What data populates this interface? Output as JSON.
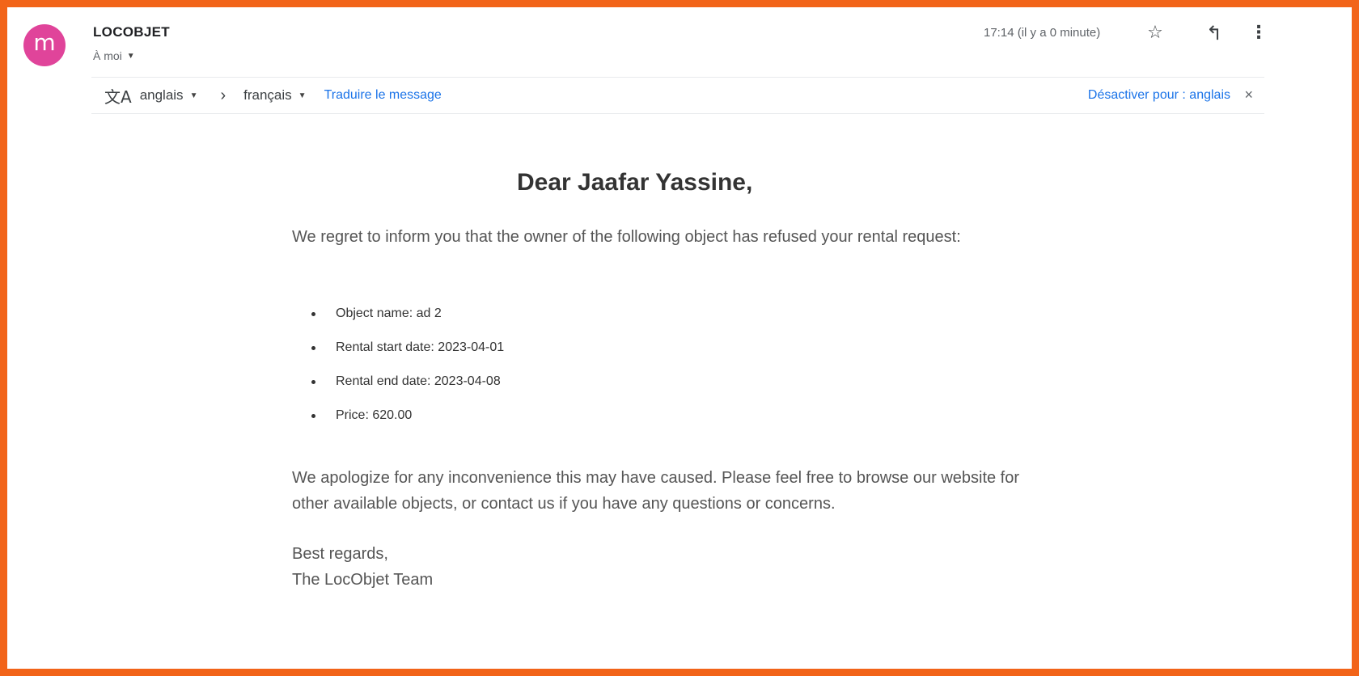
{
  "header": {
    "avatar_letter": "m",
    "sender": "LOCOBJET",
    "recipient": "À moi",
    "time": "17:14 (il y a 0 minute)",
    "icons": [
      "star-icon",
      "reply-icon",
      "more-vert-icon"
    ]
  },
  "translate_bar": {
    "from_lang": "anglais",
    "to_lang": "français",
    "translate_link": "Traduire le message",
    "disable_link": "Désactiver pour : anglais"
  },
  "email": {
    "greeting": "Dear Jaafar Yassine,",
    "intro": "We regret to inform you that the owner of the following object has refused your rental request:",
    "details": [
      "Object name: ad 2",
      "Rental start date: 2023-04-01",
      "Rental end date: 2023-04-08",
      "Price: 620.00"
    ],
    "apology": "We apologize for any inconvenience this may have caused. Please feel free to browse our website for other available objects, or contact us if you have any questions or concerns.",
    "closing": "Best regards,",
    "signature": "The LocObjet Team"
  },
  "colors": {
    "frame": "#f26419",
    "avatar": "#e0449a",
    "link": "#1a73e8"
  }
}
